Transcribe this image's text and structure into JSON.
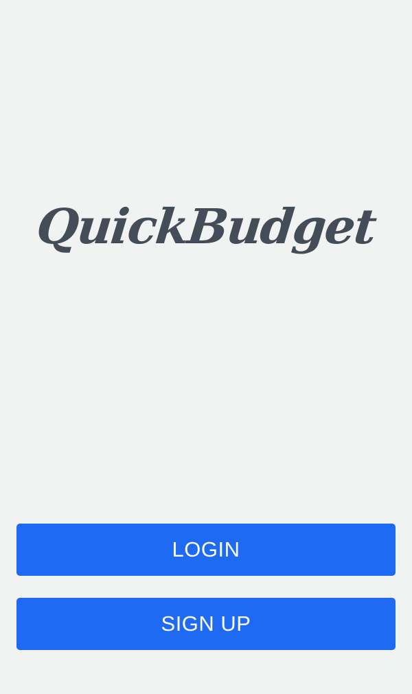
{
  "app": {
    "logo_text": "QuickBudget"
  },
  "actions": {
    "login_label": "LOGIN",
    "signup_label": "SIGN UP"
  },
  "colors": {
    "background": "#f1f2f2",
    "logo": "#434c57",
    "button_primary": "#1e6af2",
    "button_text": "#ffffff"
  }
}
